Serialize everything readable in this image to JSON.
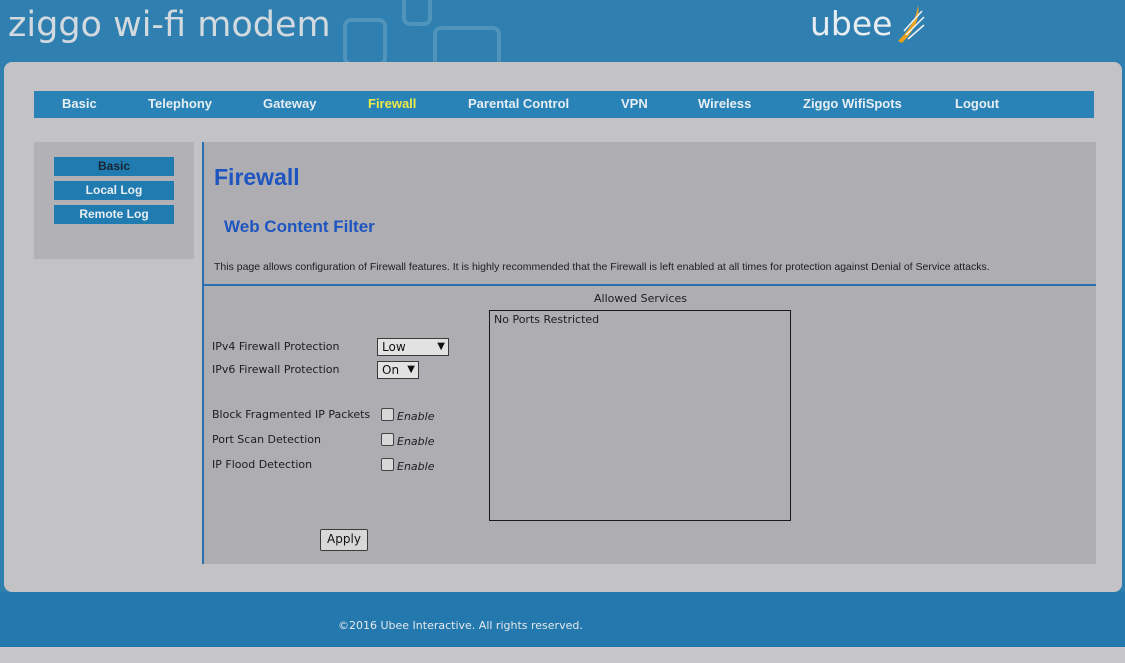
{
  "header": {
    "logo_text": "ziggo wi-fi modem",
    "brand_text": "ubee"
  },
  "nav": {
    "items": [
      {
        "label": "Basic"
      },
      {
        "label": "Telephony"
      },
      {
        "label": "Gateway"
      },
      {
        "label": "Firewall",
        "active": true
      },
      {
        "label": "Parental Control"
      },
      {
        "label": "VPN"
      },
      {
        "label": "Wireless"
      },
      {
        "label": "Ziggo WifiSpots"
      },
      {
        "label": "Logout"
      }
    ]
  },
  "sidebar": {
    "items": [
      {
        "label": "Basic",
        "active": true
      },
      {
        "label": "Local Log"
      },
      {
        "label": "Remote Log"
      }
    ]
  },
  "main": {
    "title": "Firewall",
    "subtitle": "Web Content Filter",
    "description": "This page allows configuration of Firewall features. It is highly recommended that the Firewall is left enabled at all times for protection against Denial of Service attacks.",
    "ipv4_label": "IPv4 Firewall Protection",
    "ipv4_value": "Low",
    "ipv6_label": "IPv6 Firewall Protection",
    "ipv6_value": "On",
    "block_fragmented_label": "Block Fragmented IP Packets",
    "port_scan_label": "Port Scan Detection",
    "ip_flood_label": "IP Flood Detection",
    "enable_label": "Enable",
    "block_fragmented_checked": false,
    "port_scan_checked": false,
    "ip_flood_checked": false,
    "allowed_services_title": "Allowed Services",
    "allowed_services_items": [
      "No Ports Restricted"
    ],
    "apply_label": "Apply"
  },
  "footer": {
    "copyright": "©2016 Ubee Interactive. All rights reserved."
  },
  "colors": {
    "header_bg": "#2f80b0",
    "nav_bg": "#2a83b6",
    "active_nav": "#ece94a",
    "title_blue": "#1e55c0"
  }
}
